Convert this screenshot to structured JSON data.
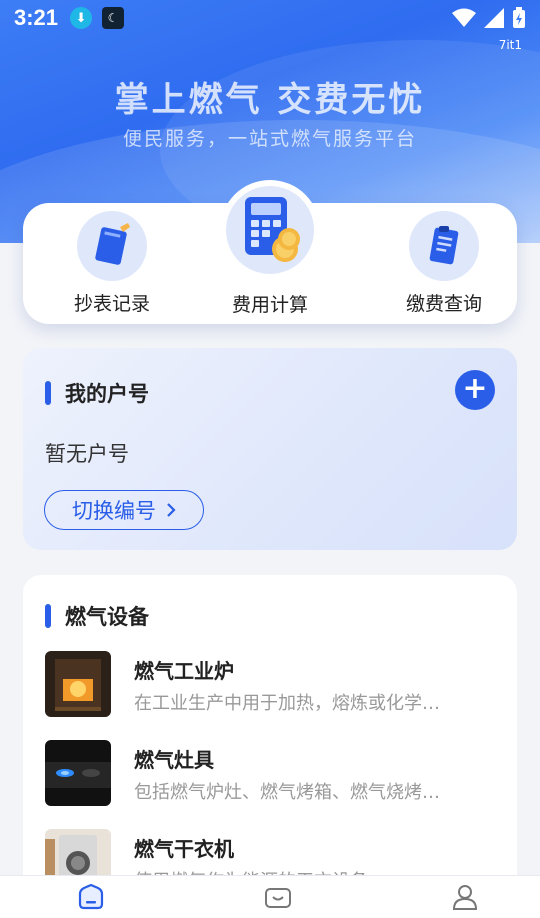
{
  "status_bar": {
    "time": "3:21",
    "carrier_badge": "7it1",
    "icons": [
      "download-icon",
      "moon-app-icon",
      "wifi-icon",
      "signal-icon",
      "battery-icon"
    ]
  },
  "banner": {
    "slogan": "掌上燃气 交费无忧",
    "subtitle": "便民服务，一站式燃气服务平台"
  },
  "quick_actions": [
    {
      "label": "抄表记录",
      "icon": "notebook-icon"
    },
    {
      "label": "费用计算",
      "icon": "calculator-icon"
    },
    {
      "label": "缴费查询",
      "icon": "document-icon"
    }
  ],
  "account": {
    "title": "我的户号",
    "empty_text": "暂无户号",
    "switch_label": "切换编号",
    "add_icon": "plus-icon"
  },
  "devices": {
    "title": "燃气设备",
    "items": [
      {
        "name": "燃气工业炉",
        "desc": "在工业生产中用于加热，熔炼或化学…"
      },
      {
        "name": "燃气灶具",
        "desc": "包括燃气炉灶、燃气烤箱、燃气烧烤…"
      },
      {
        "name": "燃气干衣机",
        "desc": "使用燃气作为能源的干衣设备"
      }
    ]
  },
  "tabbar": {
    "tabs": [
      "home-icon",
      "wallet-icon",
      "user-icon"
    ],
    "active_color": "#2a5ee8"
  },
  "colors": {
    "primary": "#2a5ee8",
    "hero": "#3d7df5"
  }
}
